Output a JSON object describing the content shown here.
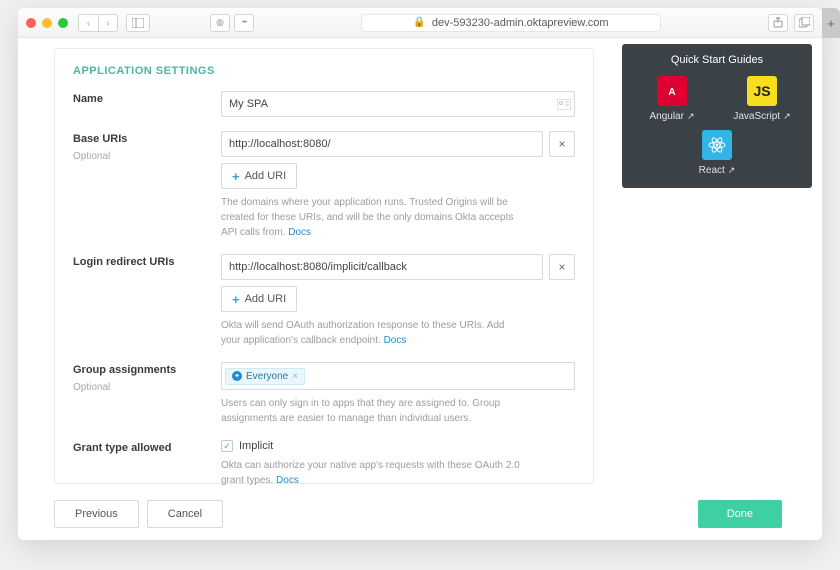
{
  "browser": {
    "url": "dev-593230-admin.oktapreview.com"
  },
  "section_title": "APPLICATION SETTINGS",
  "name": {
    "label": "Name",
    "value": "My SPA"
  },
  "base_uris": {
    "label": "Base URIs",
    "sub": "Optional",
    "value": "http://localhost:8080/",
    "add": "Add URI",
    "help_prefix": "The domains where your application runs. Trusted Origins will be created for these URIs, and will be the only domains Okta accepts API calls from. ",
    "docs": "Docs"
  },
  "redirect": {
    "label": "Login redirect URIs",
    "value": "http://localhost:8080/implicit/callback",
    "add": "Add URI",
    "help_prefix": "Okta will send OAuth authorization response to these URIs. Add your application's callback endpoint. ",
    "docs": "Docs"
  },
  "groups": {
    "label": "Group assignments",
    "sub": "Optional",
    "chip": "Everyone",
    "help": "Users can only sign in to apps that they are assigned to. Group assignments are easier to manage than individual users."
  },
  "grant": {
    "label": "Grant type allowed",
    "implicit": "Implicit",
    "help_prefix": "Okta can authorize your native app's requests with these OAuth 2.0 grant types. ",
    "docs": "Docs"
  },
  "footer": {
    "previous": "Previous",
    "cancel": "Cancel",
    "done": "Done"
  },
  "qsg": {
    "title": "Quick Start Guides",
    "angular": "Angular",
    "javascript": "JavaScript",
    "react": "React"
  }
}
